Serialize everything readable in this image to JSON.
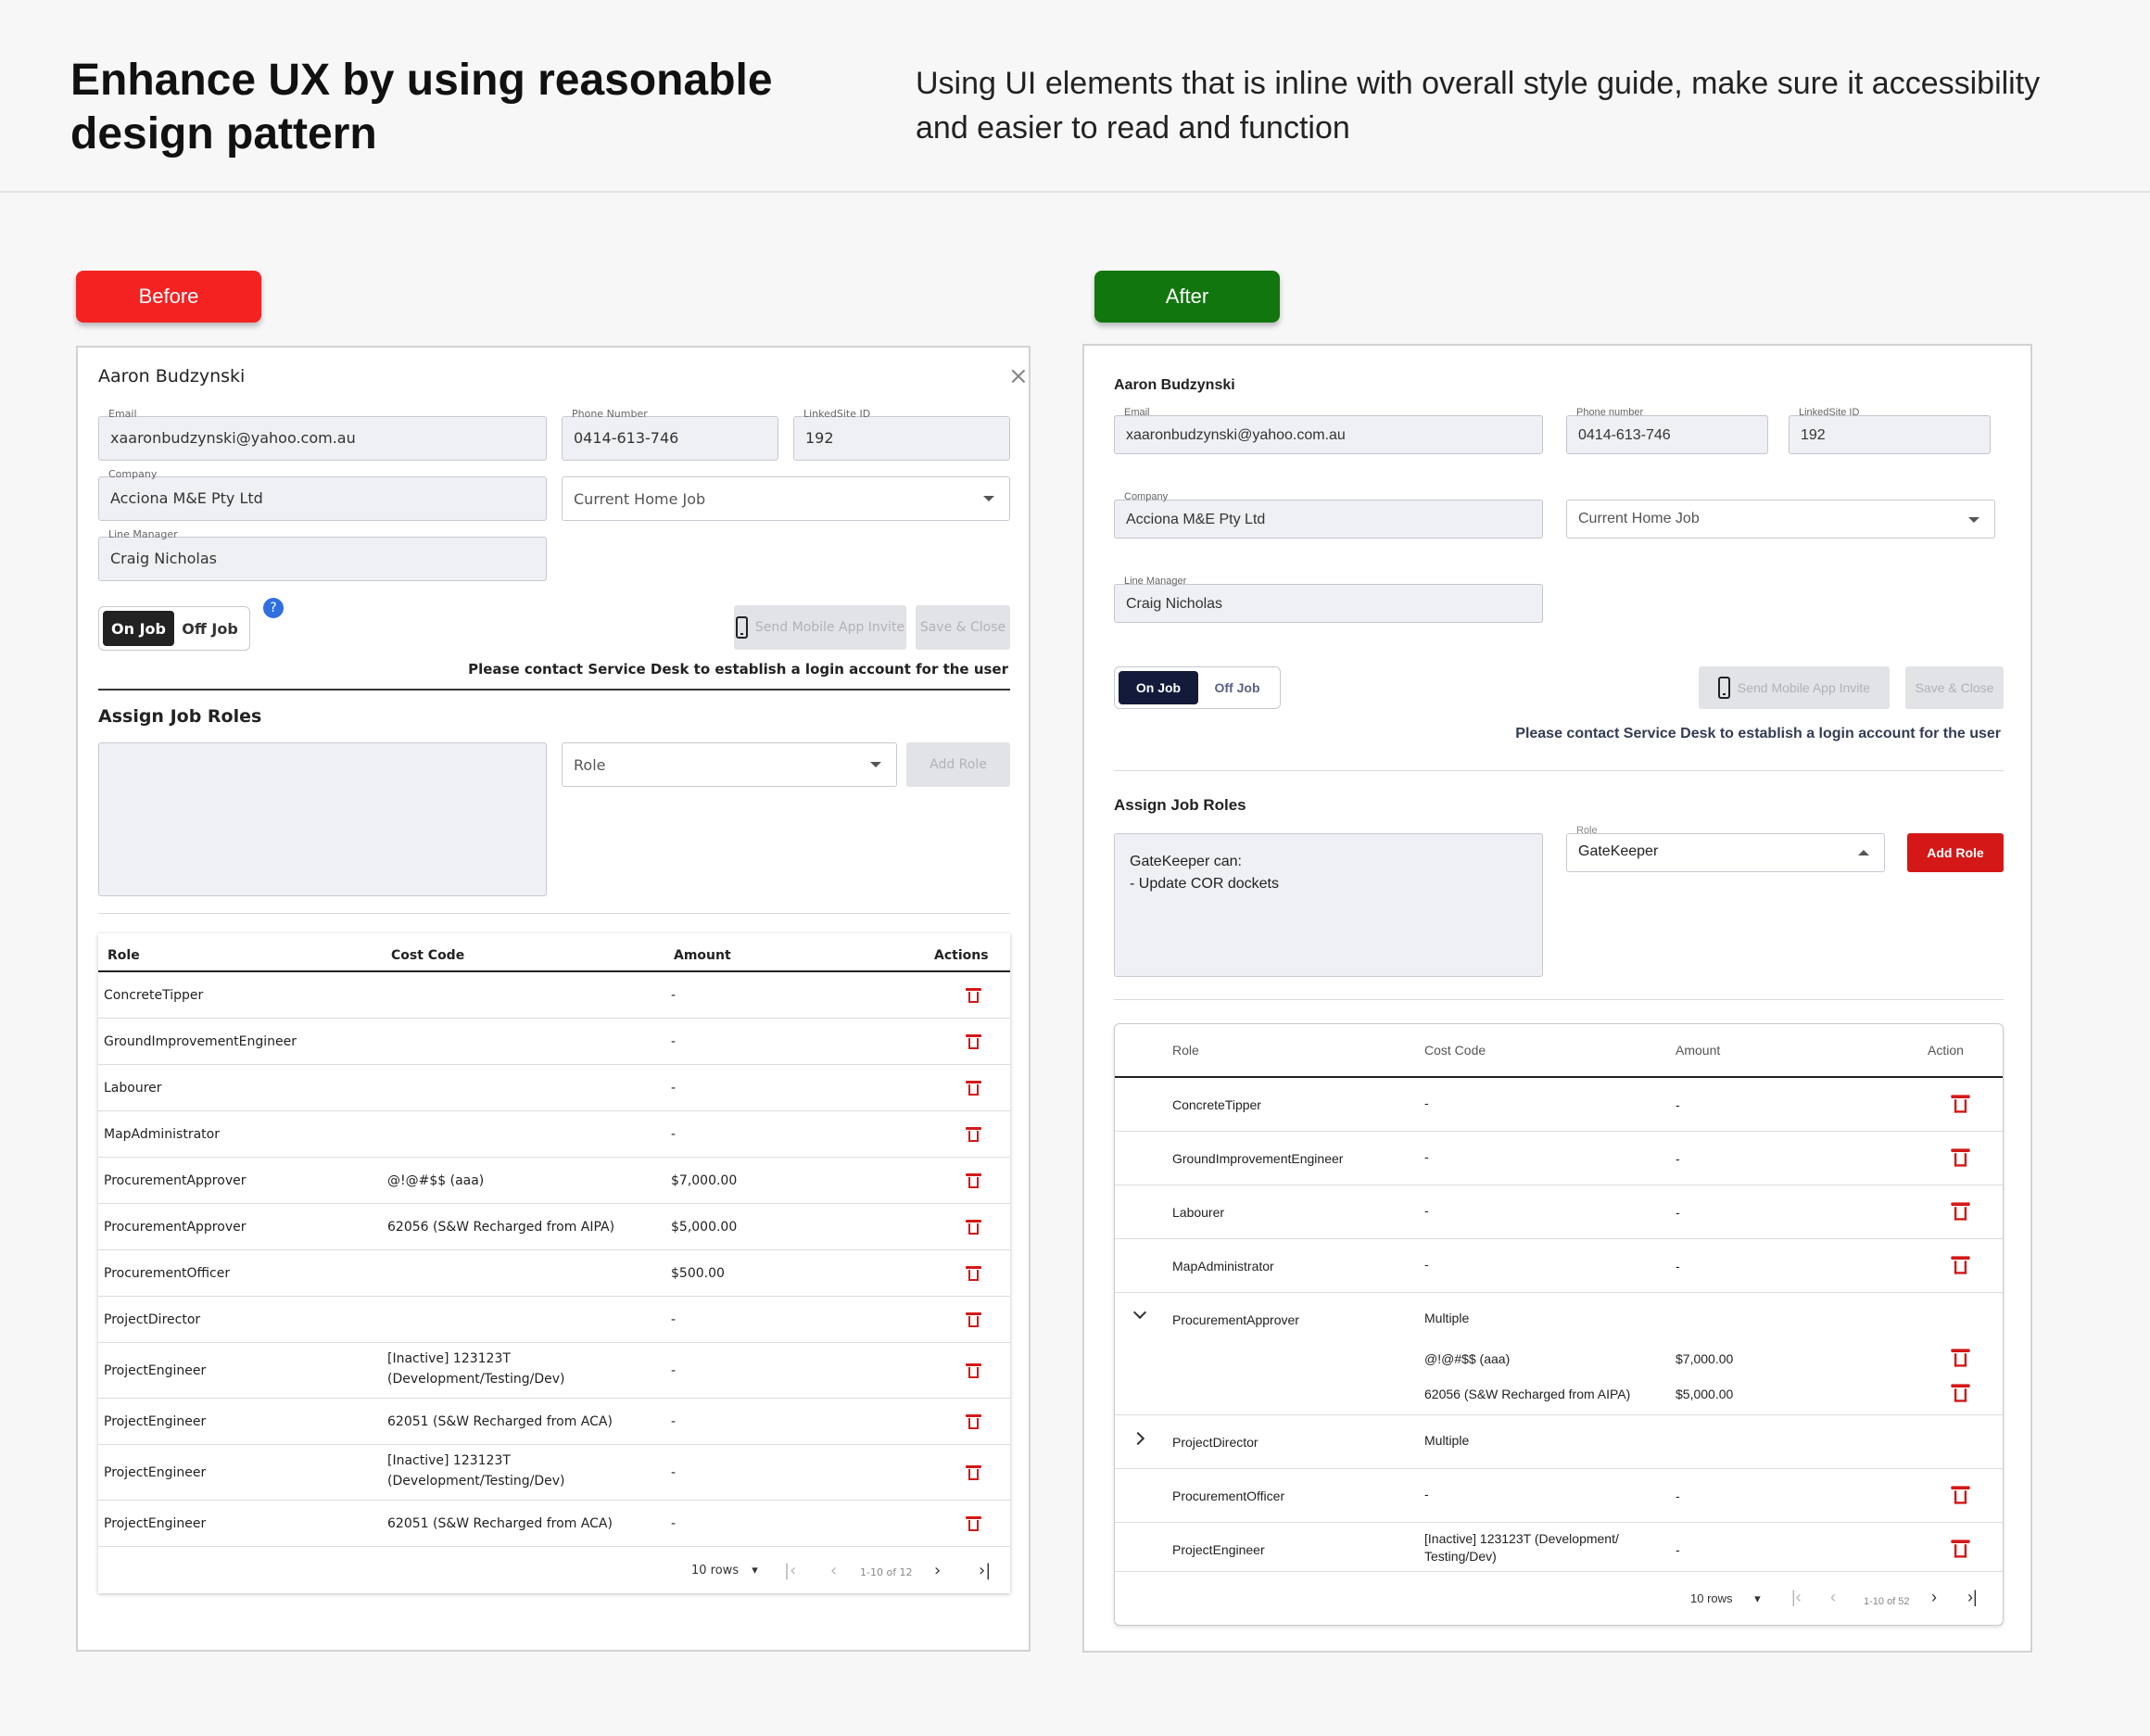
{
  "header": {
    "title": "Enhance UX by using reasonable design pattern",
    "description": "Using UI elements that is inline with overall style guide, make sure it accessibility and easier to read and function"
  },
  "tags": {
    "before": "Before",
    "after": "After"
  },
  "colors": {
    "before_tag": "#f52222",
    "after_tag": "#12760f",
    "delete": "#d41818",
    "toggle_active": "#222222"
  },
  "before": {
    "user_name": "Aaron Budzynski",
    "close_icon": "close-icon",
    "email": {
      "label": "Email",
      "value": "xaaronbudzynski@yahoo.com.au"
    },
    "phone": {
      "label": "Phone Number",
      "value": "0414-613-746"
    },
    "linkedsite": {
      "label": "LinkedSite ID",
      "value": "192"
    },
    "company": {
      "label": "Company",
      "value": "Acciona M&E Pty Ltd"
    },
    "home_job": {
      "value": "Current Home Job"
    },
    "line_manager": {
      "label": "Line Manager",
      "value": "Craig Nicholas"
    },
    "toggle": {
      "on": "On Job",
      "off": "Off Job",
      "selected": "On Job"
    },
    "help": "?",
    "send_invite": "Send Mobile App Invite",
    "save_close": "Save & Close",
    "note": "Please contact Service Desk to establish a login account for the user",
    "assign_title": "Assign Job Roles",
    "role_select": "Role",
    "add_role": "Add Role",
    "table": {
      "headers": [
        "Role",
        "Cost Code",
        "Amount",
        "Actions"
      ],
      "rows": [
        {
          "role": "ConcreteTipper",
          "cost": "",
          "amount": "-"
        },
        {
          "role": "GroundImprovementEngineer",
          "cost": "",
          "amount": "-"
        },
        {
          "role": "Labourer",
          "cost": "",
          "amount": "-"
        },
        {
          "role": "MapAdministrator",
          "cost": "",
          "amount": "-"
        },
        {
          "role": "ProcurementApprover",
          "cost": "@!@#$$ (aaa)",
          "amount": "$7,000.00"
        },
        {
          "role": "ProcurementApprover",
          "cost": "62056 (S&W Recharged from AIPA)",
          "amount": "$5,000.00"
        },
        {
          "role": "ProcurementOfficer",
          "cost": "",
          "amount": "$500.00"
        },
        {
          "role": "ProjectDirector",
          "cost": "",
          "amount": "-"
        },
        {
          "role": "ProjectEngineer",
          "cost": "[Inactive] 123123T\n(Development/Testing/Dev)",
          "amount": "-"
        },
        {
          "role": "ProjectEngineer",
          "cost": "62051 (S&W Recharged from ACA)",
          "amount": "-"
        },
        {
          "role": "ProjectEngineer",
          "cost": "[Inactive] 123123T\n(Development/Testing/Dev)",
          "amount": "-"
        },
        {
          "role": "ProjectEngineer",
          "cost": "62051 (S&W Recharged from ACA)",
          "amount": "-"
        }
      ]
    },
    "pager": {
      "rows": "10 rows",
      "range": "1-10 of 12"
    }
  },
  "after": {
    "user_name": "Aaron Budzynski",
    "email": {
      "label": "Email",
      "value": "xaaronbudzynski@yahoo.com.au"
    },
    "phone": {
      "label": "Phone number",
      "value": "0414-613-746"
    },
    "linkedsite": {
      "label": "LinkedSite ID",
      "value": "192"
    },
    "company": {
      "label": "Company",
      "value": "Acciona M&E Pty Ltd"
    },
    "home_job": {
      "value": "Current Home Job"
    },
    "line_manager": {
      "label": "Line Manager",
      "value": "Craig Nicholas"
    },
    "toggle": {
      "on": "On Job",
      "off": "Off Job",
      "selected": "On Job"
    },
    "send_invite": "Send Mobile App Invite",
    "save_close": "Save & Close",
    "note": "Please contact Service Desk to establish a login account for the user",
    "assign_title": "Assign Job Roles",
    "role_description": "GateKeeper can:\n- Update COR dockets",
    "role_select": {
      "label": "Role",
      "value": "GateKeeper"
    },
    "add_role": "Add Role",
    "table": {
      "headers": [
        "Role",
        "Cost Code",
        "Amount",
        "Action"
      ],
      "rows": [
        {
          "role": "ConcreteTipper",
          "cost": "-",
          "amount": "-"
        },
        {
          "role": "GroundImprovementEngineer",
          "cost": "-",
          "amount": "-"
        },
        {
          "role": "Labourer",
          "cost": "-",
          "amount": "-"
        },
        {
          "role": "MapAdministrator",
          "cost": "-",
          "amount": "-"
        },
        {
          "role": "ProcurementApprover",
          "cost": "Multiple",
          "amount": "",
          "expanded": true,
          "children": [
            {
              "cost": "@!@#$$ (aaa)",
              "amount": "$7,000.00"
            },
            {
              "cost": "62056 (S&W Recharged from AIPA)",
              "amount": "$5,000.00"
            }
          ]
        },
        {
          "role": "ProjectDirector",
          "cost": "Multiple",
          "amount": "",
          "expanded": false
        },
        {
          "role": "ProcurementOfficer",
          "cost": "-",
          "amount": "-"
        },
        {
          "role": "ProjectEngineer",
          "cost": "[Inactive] 123123T (Development/\nTesting/Dev)",
          "amount": "-"
        }
      ]
    },
    "pager": {
      "rows": "10 rows",
      "range": "1-10 of 52"
    }
  }
}
